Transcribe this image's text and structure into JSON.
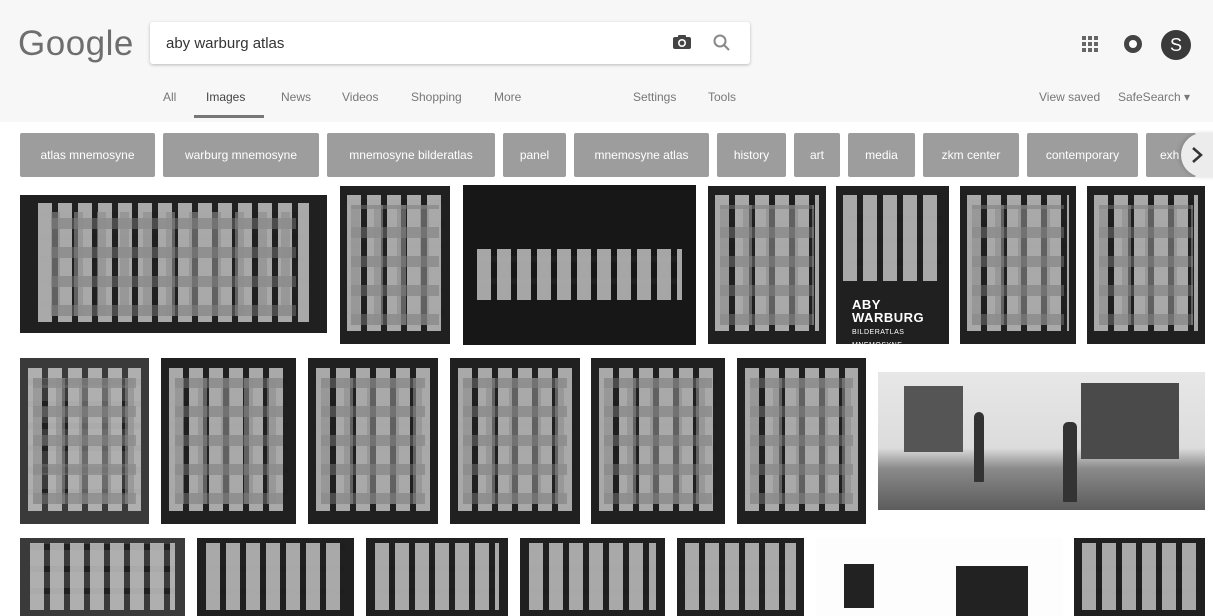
{
  "header": {
    "logo": "Google",
    "search_value": "aby warburg atlas",
    "avatar_letter": "S"
  },
  "tabs": {
    "all": "All",
    "images": "Images",
    "news": "News",
    "videos": "Videos",
    "shopping": "Shopping",
    "more": "More",
    "settings": "Settings",
    "tools": "Tools",
    "view_saved": "View saved",
    "safesearch": "SafeSearch ▾"
  },
  "chips": [
    "atlas mnemosyne",
    "warburg mnemosyne",
    "mnemosyne bilderatlas",
    "panel",
    "mnemosyne atlas",
    "history",
    "art",
    "media",
    "zkm center",
    "contemporary",
    "exh"
  ],
  "thumb_caption": {
    "title": "ABY WARBURG",
    "subtitle": "BILDERATLAS MNEMOSYNE"
  },
  "colors": {
    "chip_bg": "#9d9d9d",
    "topbar_bg": "#f7f7f7"
  }
}
